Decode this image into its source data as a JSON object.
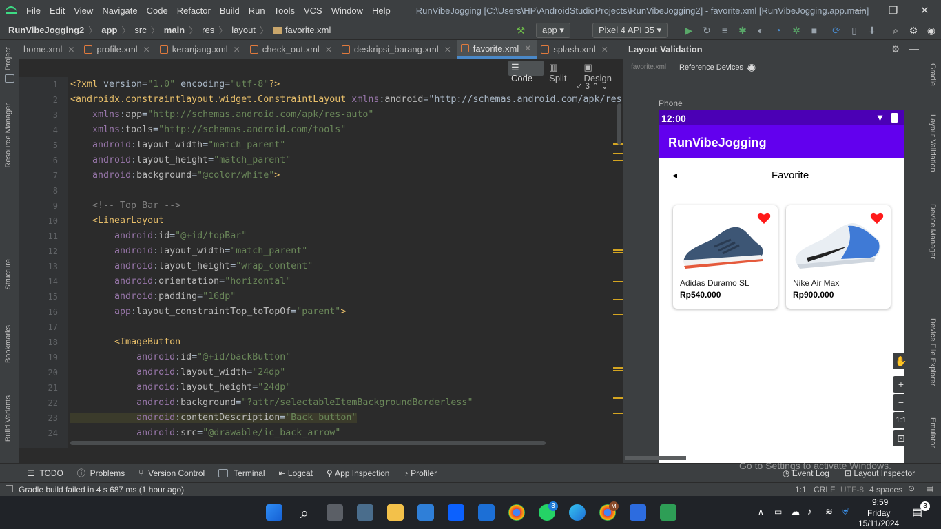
{
  "titlebar": {
    "menu": [
      "File",
      "Edit",
      "View",
      "Navigate",
      "Code",
      "Refactor",
      "Build",
      "Run",
      "Tools",
      "VCS",
      "Window",
      "Help"
    ],
    "title": "RunVibeJogging [C:\\Users\\HP\\AndroidStudioProjects\\RunVibeJogging2] - favorite.xml [RunVibeJogging.app.main]",
    "min": "—",
    "max": "❐",
    "close": "✕"
  },
  "breadcrumb": [
    "RunVibeJogging2",
    "app",
    "src",
    "main",
    "res",
    "layout",
    "favorite.xml"
  ],
  "toolbar": {
    "module": "app",
    "device": "Pixel 4 API 35"
  },
  "tabs": [
    {
      "label": "home.xml"
    },
    {
      "label": "profile.xml"
    },
    {
      "label": "keranjang.xml"
    },
    {
      "label": "check_out.xml"
    },
    {
      "label": "deskripsi_barang.xml"
    },
    {
      "label": "favorite.xml",
      "active": true
    },
    {
      "label": "splash.xml"
    }
  ],
  "modes": [
    "Code",
    "Split",
    "Design"
  ],
  "editor": {
    "warnings": "3"
  },
  "lines": [
    [
      "1",
      "<?xml version=\"1.0\" encoding=\"utf-8\"?>"
    ],
    [
      "2",
      "<androidx.constraintlayout.widget.ConstraintLayout xmlns:android=\"http://schemas.android.com/apk/res"
    ],
    [
      "3",
      "    xmlns:app=\"http://schemas.android.com/apk/res-auto\""
    ],
    [
      "4",
      "    xmlns:tools=\"http://schemas.android.com/tools\""
    ],
    [
      "5",
      "    android:layout_width=\"match_parent\""
    ],
    [
      "6",
      "    android:layout_height=\"match_parent\""
    ],
    [
      "7",
      "    android:background=\"@color/white\">"
    ],
    [
      "8",
      ""
    ],
    [
      "9",
      "    <!-- Top Bar -->"
    ],
    [
      "10",
      "    <LinearLayout"
    ],
    [
      "11",
      "        android:id=\"@+id/topBar\""
    ],
    [
      "12",
      "        android:layout_width=\"match_parent\""
    ],
    [
      "13",
      "        android:layout_height=\"wrap_content\""
    ],
    [
      "14",
      "        android:orientation=\"horizontal\""
    ],
    [
      "15",
      "        android:padding=\"16dp\""
    ],
    [
      "16",
      "        app:layout_constraintTop_toTopOf=\"parent\">"
    ],
    [
      "17",
      ""
    ],
    [
      "18",
      "        <ImageButton"
    ],
    [
      "19",
      "            android:id=\"@+id/backButton\""
    ],
    [
      "20",
      "            android:layout_width=\"24dp\""
    ],
    [
      "21",
      "            android:layout_height=\"24dp\""
    ],
    [
      "22",
      "            android:background=\"?attr/selectableItemBackgroundBorderless\""
    ],
    [
      "23",
      "            android:contentDescription=\"Back button\""
    ],
    [
      "24",
      "            android:src=\"@drawable/ic_back_arrow\""
    ]
  ],
  "layout_validation": {
    "title": "Layout Validation",
    "file": "favorite.xml",
    "ref": "Reference Devices",
    "phone_label": "Phone"
  },
  "phone": {
    "time": "12:00",
    "app_title": "RunVibeJogging",
    "page_title": "Favorite",
    "back": "◂",
    "products": [
      {
        "name": "Adidas Duramo SL",
        "price": "Rp540.000"
      },
      {
        "name": "Nike Air Max",
        "price": "Rp900.000"
      }
    ]
  },
  "zoom": {
    "plus": "+",
    "minus": "−",
    "ratio": "1:1"
  },
  "left_tools": [
    "Project",
    "Resource Manager",
    "Structure",
    "Bookmarks",
    "Build Variants"
  ],
  "right_tools": [
    "Gradle",
    "Layout Validation",
    "Device Manager",
    "Device File Explorer",
    "Emulator"
  ],
  "bottom_tools": [
    "TODO",
    "Problems",
    "Version Control",
    "Terminal",
    "Logcat",
    "App Inspection",
    "Profiler"
  ],
  "bottom_right": [
    "Event Log",
    "Layout Inspector"
  ],
  "status": {
    "message": "Gradle build failed in 4 s 687 ms (1 hour ago)",
    "pos": "1:1",
    "eol": "CRLF",
    "enc": "UTF-8",
    "indent": "4 spaces"
  },
  "watermark": {
    "line1": "Activate Windows",
    "line2": "Go to Settings to activate Windows."
  },
  "taskbar": {
    "time": "9:59",
    "day": "Friday",
    "date": "15/11/2024",
    "badge": "3",
    "whatsapp_badge": "3",
    "m": "M"
  },
  "colors": {
    "purple": "#6200ee",
    "purple_dark": "#4b00b5",
    "heart": "#ff1a1a"
  }
}
